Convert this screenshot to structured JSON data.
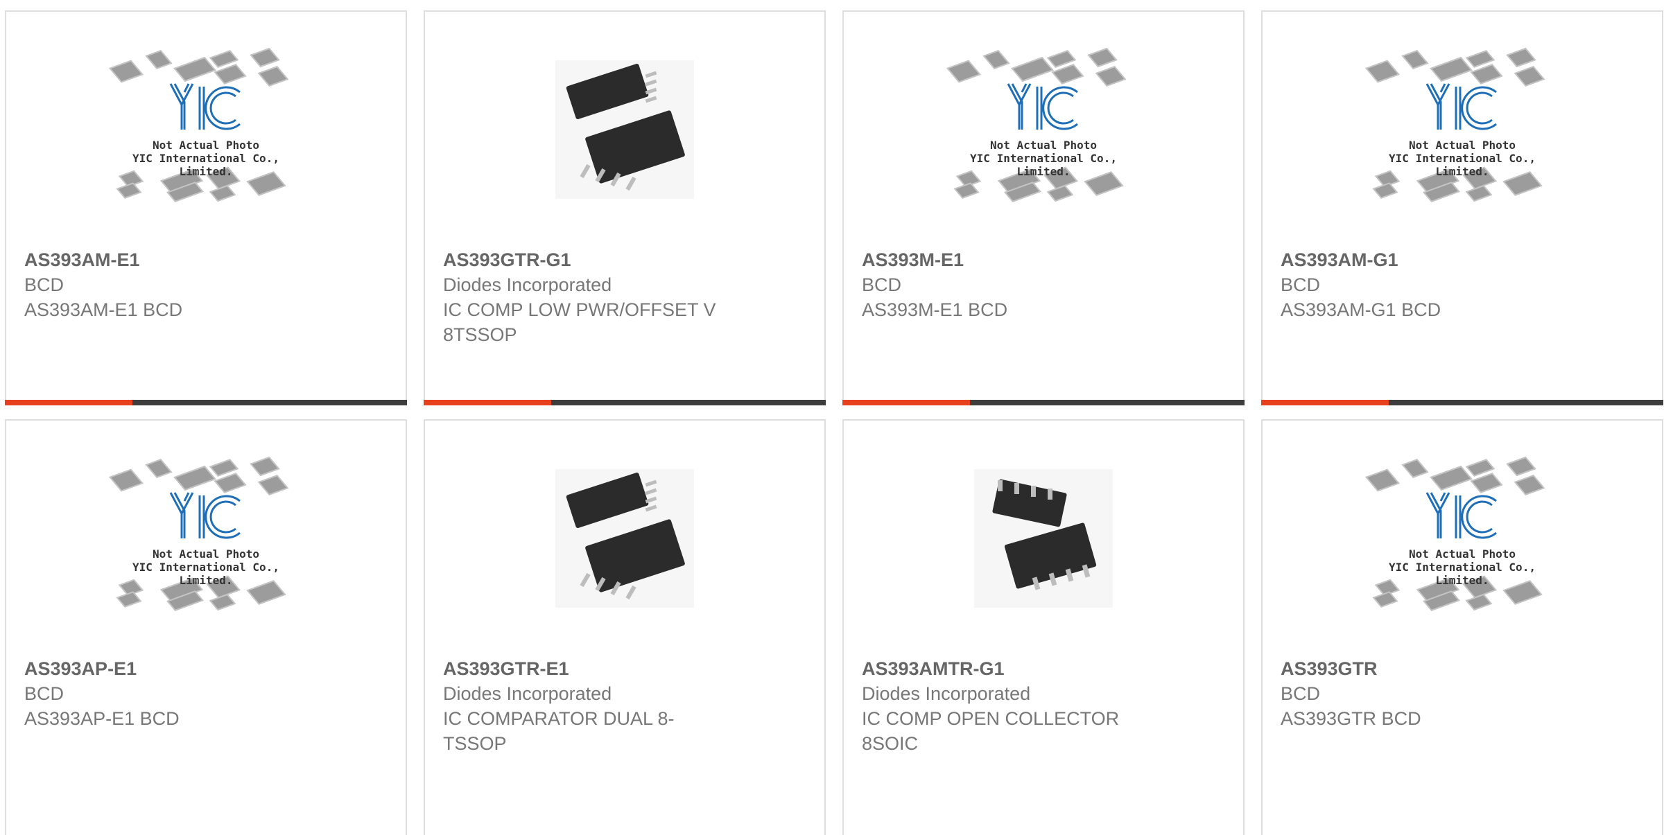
{
  "cards": [
    {
      "part": "AS393AM-E1",
      "maker": "BCD",
      "desc": "AS393AM-E1 BCD",
      "image": "placeholder"
    },
    {
      "part": "AS393GTR-G1",
      "maker": "Diodes Incorporated",
      "desc": "IC COMP LOW PWR/OFFSET V 8TSSOP",
      "image": "tssop"
    },
    {
      "part": "AS393M-E1",
      "maker": "BCD",
      "desc": "AS393M-E1 BCD",
      "image": "placeholder"
    },
    {
      "part": "AS393AM-G1",
      "maker": "BCD",
      "desc": "AS393AM-G1 BCD",
      "image": "placeholder"
    },
    {
      "part": "AS393AP-E1",
      "maker": "BCD",
      "desc": "AS393AP-E1 BCD",
      "image": "placeholder"
    },
    {
      "part": "AS393GTR-E1",
      "maker": "Diodes Incorporated",
      "desc": "IC COMPARATOR DUAL 8-TSSOP",
      "image": "tssop"
    },
    {
      "part": "AS393AMTR-G1",
      "maker": "Diodes Incorporated",
      "desc": "IC COMP OPEN COLLECTOR 8SOIC",
      "image": "soic"
    },
    {
      "part": "AS393GTR",
      "maker": "BCD",
      "desc": "AS393GTR BCD",
      "image": "placeholder"
    }
  ],
  "placeholder": {
    "logo": "YIC",
    "line1": "Not Actual Photo",
    "line2": "YIC International Co., Limited."
  },
  "colors": {
    "accent": "#e8401c",
    "bar": "#3d3d3d",
    "logo": "#1e6fb8"
  }
}
